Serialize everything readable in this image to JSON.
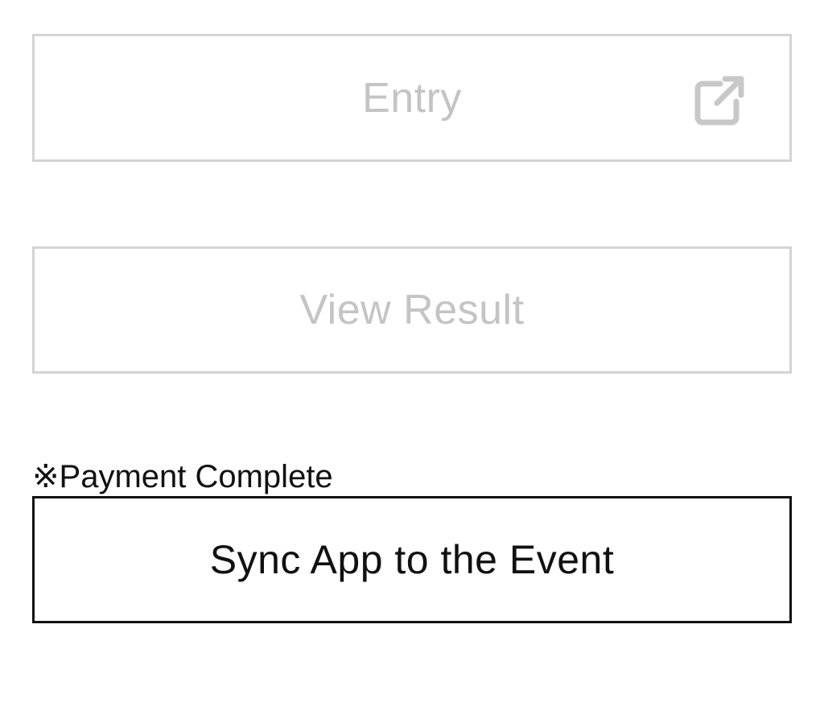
{
  "buttons": {
    "entry_label": "Entry",
    "view_result_label": "View Result",
    "sync_label": "Sync App to the Event"
  },
  "payment_note": "※Payment Complete",
  "icons": {
    "entry_icon": "external-link-icon"
  },
  "colors": {
    "disabled_border": "#d3d3d3",
    "disabled_text": "#c4c4c4",
    "active_border": "#111111",
    "active_text": "#111111",
    "background": "#ffffff"
  }
}
